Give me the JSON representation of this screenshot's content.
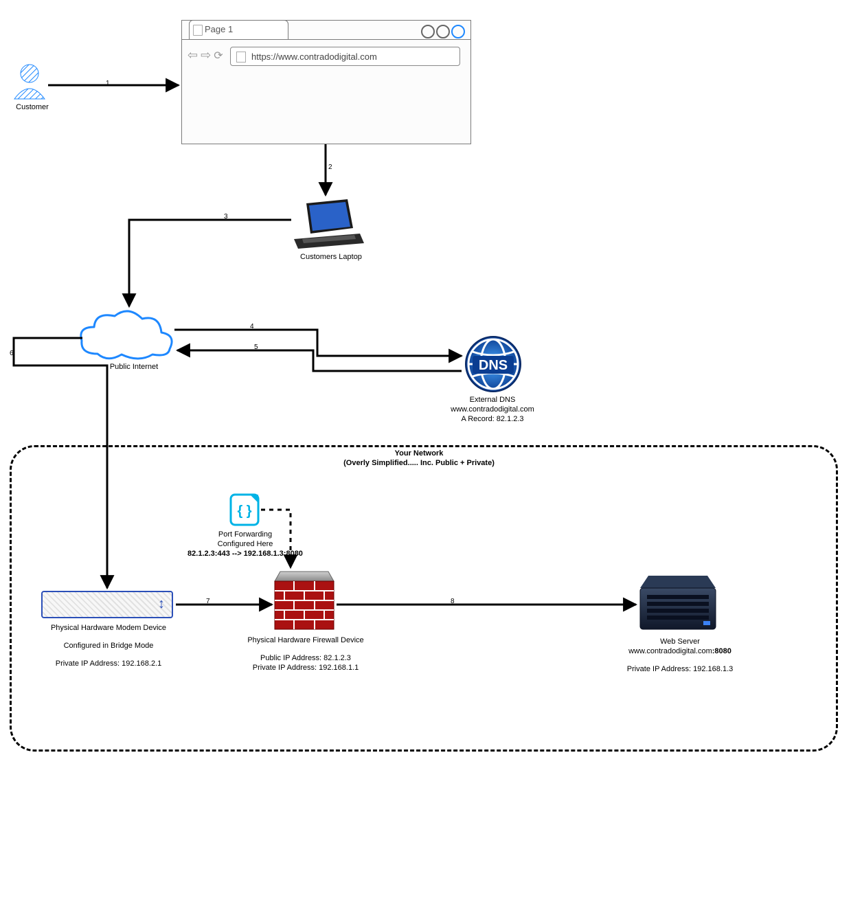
{
  "browser": {
    "tab_label": "Page 1",
    "url": "https://www.contradodigital.com"
  },
  "nodes": {
    "customer": "Customer",
    "laptop": "Customers Laptop",
    "internet": "Public Internet",
    "dns_title": "External DNS",
    "dns_domain": "www.contradodigital.com",
    "dns_record": "A Record: 82.1.2.3",
    "your_network_title": "Your Network",
    "your_network_sub": "(Overly Simplified..... Inc. Public + Private)",
    "port_fwd_l1": "Port Forwarding",
    "port_fwd_l2": "Configured Here",
    "port_fwd_l3": "82.1.2.3:443 --> 192.168.1.3:8080",
    "modem_title": "Physical Hardware Modem Device",
    "modem_l2": "Configured in Bridge Mode",
    "modem_l3": "Private IP Address: 192.168.2.1",
    "fw_title": "Physical Hardware Firewall Device",
    "fw_l2": "Public IP Address: 82.1.2.3",
    "fw_l3": "Private IP Address: 192.168.1.1",
    "web_title": "Web Server",
    "web_l2": "www.contradodigital.com:8080",
    "web_l3": "Private IP Address: 192.168.1.3"
  },
  "steps": {
    "s1": "1",
    "s2": "2",
    "s3": "3",
    "s4": "4",
    "s5": "5",
    "s6": "6",
    "s7": "7",
    "s8": "8"
  }
}
